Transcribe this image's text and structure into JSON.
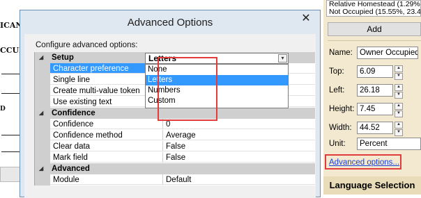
{
  "background_doc": {
    "lines": [
      "ICAN",
      "CCUPY",
      "",
      ""
    ],
    "mark": "D"
  },
  "dialog": {
    "title": "Advanced Options",
    "close_glyph": "✕",
    "caption": "Configure advanced options:",
    "categories": [
      {
        "name": "Setup",
        "toggle": "◢",
        "props": [
          {
            "label": "Character preference",
            "value": ""
          },
          {
            "label": "Single line",
            "value": "None"
          },
          {
            "label": "Create multi-value token",
            "value": "Letters"
          },
          {
            "label": "Use existing text",
            "value": ""
          }
        ]
      },
      {
        "name": "Confidence",
        "toggle": "◢",
        "props": [
          {
            "label": "Confidence",
            "value": "0"
          },
          {
            "label": "Confidence method",
            "value": "Average"
          },
          {
            "label": "Clear data",
            "value": "False"
          },
          {
            "label": "Mark field",
            "value": "False"
          }
        ]
      },
      {
        "name": "Advanced",
        "toggle": "◢",
        "props": [
          {
            "label": "Module",
            "value": "Default"
          }
        ]
      }
    ],
    "combo": {
      "value": "Letters",
      "arrow": "▾",
      "options": [
        "None",
        "Letters",
        "Numbers",
        "Custom"
      ],
      "highlighted": "Letters"
    }
  },
  "right_panel": {
    "occupancy_list": [
      "Relative Homestead (1.29%",
      "Not Occupied (15.55%, 23.4"
    ],
    "add_label": "Add",
    "name_label": "Name:",
    "name_value": "Owner Occupied",
    "top_label": "Top:",
    "top_value": "6.09",
    "left_label": "Left:",
    "left_value": "26.18",
    "height_label": "Height:",
    "height_value": "7.45",
    "width_label": "Width:",
    "width_value": "44.52",
    "unit_label": "Unit:",
    "unit_value": "Percent",
    "advanced_link": "Advanced options...",
    "language_header": "Language Selection"
  },
  "colors": {
    "highlight": "#3399ff",
    "annotation_red": "#e23b3b",
    "panel_bg": "#f3e9d0",
    "link": "#1a3fd6"
  }
}
